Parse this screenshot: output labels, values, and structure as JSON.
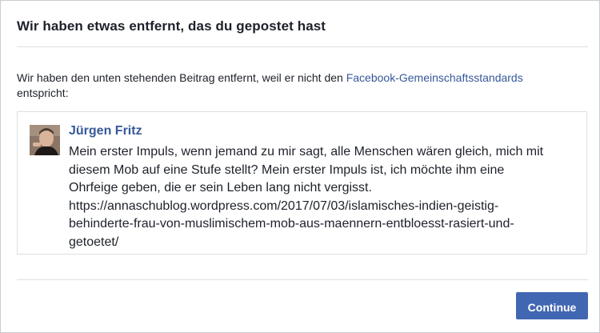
{
  "dialog": {
    "title": "Wir haben etwas entfernt, das du gepostet hast",
    "intro_text": "Wir haben den unten stehenden Beitrag entfernt, weil er nicht den ",
    "standards_link": "Facebook-Gemeinschaftsstandards",
    "intro_suffix": "entspricht:",
    "continue_label": "Continue"
  },
  "post": {
    "author": "Jürgen Fritz",
    "text": "Mein erster Impuls, wenn jemand zu mir sagt, alle Menschen wären gleich, mich mit\ndiesem Mob auf eine Stufe stellt? Mein erster Impuls ist, ich möchte ihm eine\nOhrfeige geben, die er sein Leben lang nicht vergisst.\nhttps://annaschublog.wordpress.com/2017/07/03/islamisches-indien-geistig-\nbehinderte-frau-von-muslimischem-mob-aus-maennern-entbloesst-rasiert-und-\ngetoetet/"
  },
  "colors": {
    "link": "#365899",
    "button": "#4267b2",
    "text": "#1d2129",
    "divider": "#dddfe2"
  }
}
